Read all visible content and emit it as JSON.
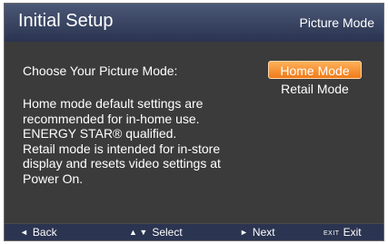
{
  "header": {
    "title": "Initial Setup",
    "section": "Picture Mode"
  },
  "content": {
    "prompt": "Choose Your Picture Mode:",
    "description_lines": [
      "Home mode default settings are",
      "recommended for in-home use.",
      "ENERGY STAR® qualified.",
      "Retail mode is intended for in-store",
      "display and resets video settings at",
      "Power On."
    ]
  },
  "options": [
    {
      "label": "Home Mode",
      "selected": true
    },
    {
      "label": "Retail Mode",
      "selected": false
    }
  ],
  "footer": {
    "back": {
      "icon": "left-triangle-icon",
      "glyph": "◄",
      "label": "Back"
    },
    "select": {
      "icon": "up-down-arrows-icon",
      "glyph": "▲ ▼",
      "label": "Select"
    },
    "next": {
      "icon": "right-triangle-icon",
      "glyph": "►",
      "label": "Next"
    },
    "exit": {
      "icon": "exit-key-icon",
      "glyph": "EXIT",
      "label": "Exit"
    }
  },
  "colors": {
    "accent": "#f59a3a",
    "header": "#3a4665",
    "background": "#3b3b3b"
  }
}
